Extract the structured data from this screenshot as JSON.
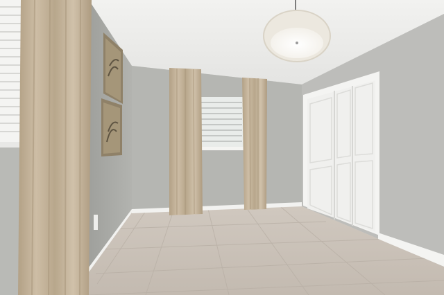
{
  "scene": {
    "description_type": "empty-room-photo",
    "colors": {
      "wall_left": "#a9aaa6",
      "wall_back": "#b6b7b3",
      "wall_right": "#bdbdba",
      "ceiling": "#eeeeec",
      "floor": "#c9c1b8",
      "curtain": "#c4b49c",
      "trim": "#f4f4f2",
      "door": "#f3f3f1",
      "window_glass": "#dfe3e2",
      "frame_art": "#8f8168"
    }
  }
}
